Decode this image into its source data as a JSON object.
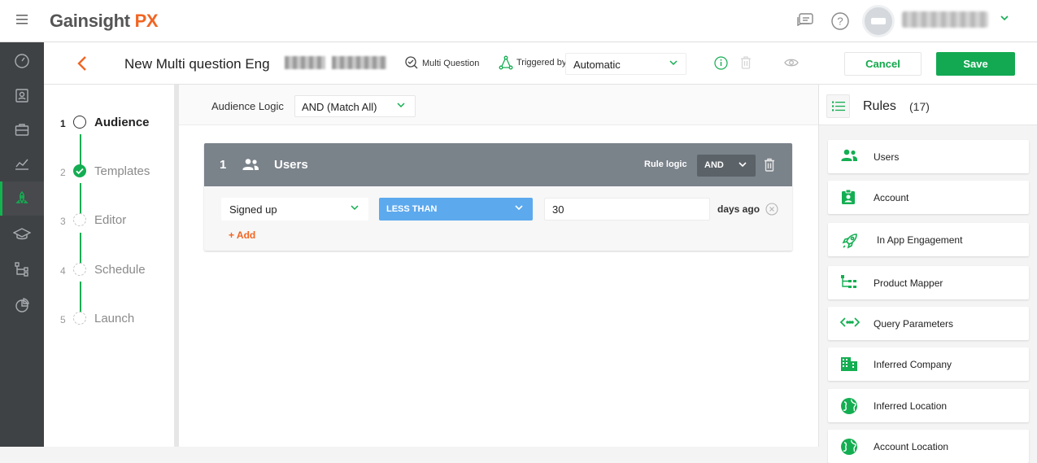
{
  "app": {
    "logo_text": "Gainsight",
    "logo_accent": "PX"
  },
  "colors": {
    "accent_green": "#12b44f",
    "accent_orange": "#f26522",
    "operator_blue": "#5ca9ee",
    "card_header": "#7a828a"
  },
  "header": {
    "title": "New Multi question Eng",
    "mode_label": "Multi Question",
    "triggered_label": "Triggered by",
    "triggered_value": "Automatic",
    "cancel_label": "Cancel",
    "save_label": "Save"
  },
  "steps": [
    {
      "num": "1",
      "label": "Audience",
      "state": "current"
    },
    {
      "num": "2",
      "label": "Templates",
      "state": "done"
    },
    {
      "num": "3",
      "label": "Editor",
      "state": "pending"
    },
    {
      "num": "4",
      "label": "Schedule",
      "state": "pending"
    },
    {
      "num": "5",
      "label": "Launch",
      "state": "pending"
    }
  ],
  "audience": {
    "logic_label": "Audience Logic",
    "logic_value": "AND (Match All)",
    "rule_group": {
      "number": "1",
      "title": "Users",
      "rule_logic_label": "Rule logic",
      "rule_logic_value": "AND",
      "condition": {
        "field": "Signed up",
        "operator": "LESS THAN",
        "value": "30",
        "unit": "days ago"
      },
      "add_label": "+ Add"
    }
  },
  "rules_panel": {
    "title": "Rules",
    "count": "(17)",
    "items": [
      {
        "label": "Users",
        "icon": "users-icon"
      },
      {
        "label": "Account",
        "icon": "account-badge-icon"
      },
      {
        "label": "In App Engagement",
        "icon": "rocket-icon"
      },
      {
        "label": "Product Mapper",
        "icon": "tree-icon"
      },
      {
        "label": "Query Parameters",
        "icon": "code-arrows-icon"
      },
      {
        "label": "Inferred Company",
        "icon": "building-icon"
      },
      {
        "label": "Inferred Location",
        "icon": "globe-icon"
      },
      {
        "label": "Account Location",
        "icon": "globe-icon"
      }
    ]
  }
}
